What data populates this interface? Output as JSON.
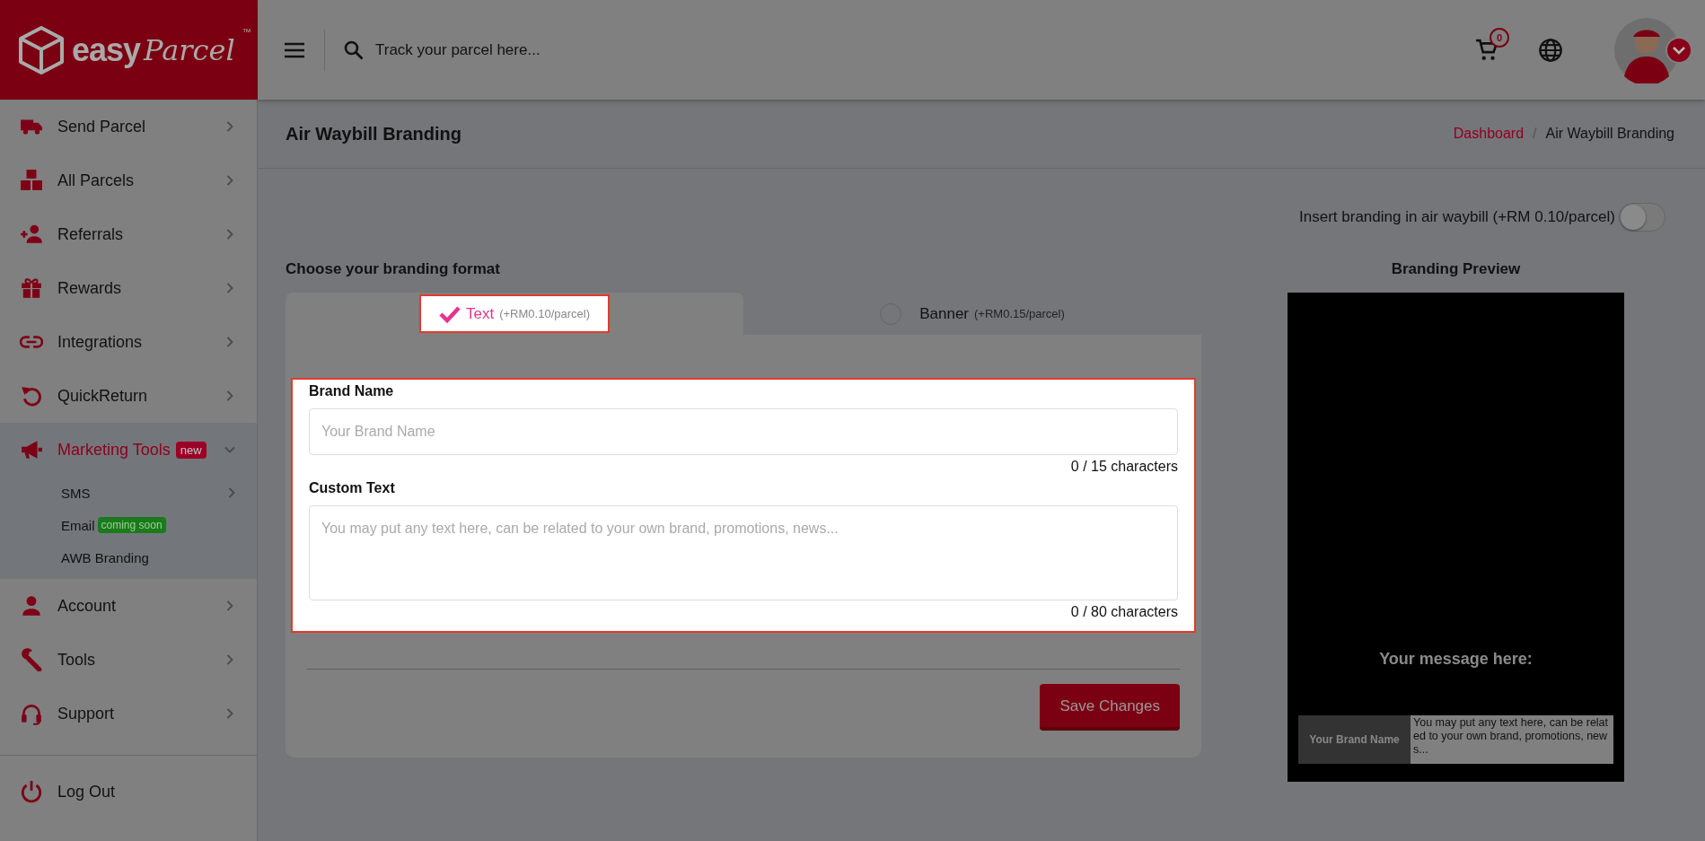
{
  "header": {
    "logo": {
      "word": "easy",
      "script": "Parcel",
      "mark": "™"
    },
    "search": {
      "placeholder": "Track your parcel here..."
    },
    "cart": {
      "count": "0"
    }
  },
  "sidebar": {
    "items": [
      {
        "label": "Send Parcel",
        "selected": false,
        "expanded": false
      },
      {
        "label": "All Parcels",
        "selected": false,
        "expanded": false
      },
      {
        "label": "Referrals",
        "selected": false,
        "expanded": false
      },
      {
        "label": "Rewards",
        "selected": false,
        "expanded": false
      },
      {
        "label": "Integrations",
        "selected": false,
        "expanded": false
      },
      {
        "label": "QuickReturn",
        "selected": false,
        "expanded": false
      },
      {
        "label": "Marketing Tools",
        "selected": true,
        "expanded": true,
        "badge": {
          "text": "new",
          "color": "#9a0026"
        },
        "children": [
          {
            "label": "SMS",
            "selected": false,
            "expanded": false
          },
          {
            "label": "Email",
            "selected": false,
            "badge": {
              "text": "coming soon",
              "color": "#1b7a1b"
            }
          },
          {
            "label": "AWB Branding",
            "selected": false
          }
        ]
      },
      {
        "label": "Account",
        "selected": false,
        "expanded": false
      },
      {
        "label": "Tools",
        "selected": false,
        "expanded": false
      },
      {
        "label": "Support",
        "selected": false,
        "expanded": false
      }
    ],
    "logout": "Log Out"
  },
  "page": {
    "title": "Air Waybill Branding",
    "breadcrumb": {
      "separator": "/",
      "items": [
        {
          "label": "Dashboard",
          "link": true
        },
        {
          "label": "Air Waybill Branding",
          "link": false
        }
      ]
    }
  },
  "branding": {
    "toggle": {
      "label": "Insert branding in air waybill (+RM 0.10/parcel)",
      "on": false
    },
    "heading": "Choose your branding format",
    "tabs": [
      {
        "label": "Text",
        "note": "(+RM0.10/parcel)",
        "selected": true
      },
      {
        "label": "Banner",
        "note": "(+RM0.15/parcel)",
        "selected": false
      }
    ],
    "fields": [
      {
        "kind": "input",
        "label": "Brand Name",
        "placeholder": "Your Brand Name",
        "counter": "0 / 15 characters"
      },
      {
        "kind": "textarea",
        "label": "Custom Text",
        "placeholder": "You may put any text here, can be related to your own brand, promotions, news...",
        "counter": "0 / 80 characters"
      }
    ],
    "save_button": "Save Changes"
  },
  "preview": {
    "title": "Branding Preview",
    "message": "Your message here:",
    "brand": "Your Brand Name",
    "text": "You may put any text here, can be related to your own brand, promotions, news..."
  }
}
